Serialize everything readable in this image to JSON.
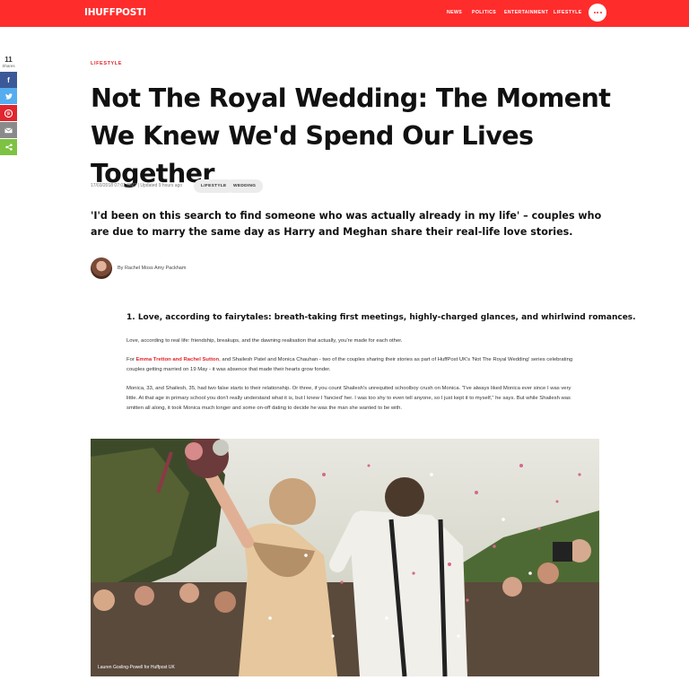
{
  "header": {
    "logo": "IHUFFPOSTI",
    "nav": [
      "NEWS",
      "POLITICS",
      "ENTERTAINMENT",
      "LIFESTYLE"
    ],
    "brand_color": "#ff2c2c"
  },
  "share": {
    "count": "11",
    "label": "Shares",
    "buttons": [
      {
        "name": "facebook",
        "glyph": "f",
        "color": "#3b5998"
      },
      {
        "name": "twitter",
        "glyph": "t",
        "color": "#55acee"
      },
      {
        "name": "pinterest",
        "glyph": "p",
        "color": "#e0262e"
      },
      {
        "name": "email",
        "glyph": "✉",
        "color": "#8a8a8a"
      },
      {
        "name": "share",
        "glyph": "<",
        "color": "#7dc242"
      }
    ]
  },
  "article": {
    "section": "LIFESTYLE",
    "headline": "Not The Royal Wedding: The Moment We Knew We'd Spend Our Lives Together",
    "timestamp": "17/03/2018 07:01 GMT | Updated 9 hours ago",
    "tags": [
      "LIFESTYLE",
      "WEDDING"
    ],
    "standfirst": "'I'd been on this search to find someone who was actually already in my life' – couples who are due to marry the same day as Harry and Meghan share their real-life love stories.",
    "byline": "By Rachel Moss  Amy Packham",
    "subhead": "1. Love, according to fairytales: breath-taking first meetings, highly-charged glances, and whirlwind romances.",
    "p1": "Love, according to real life: friendship, breakups, and the dawning realisation that actually, you're made for each other.",
    "p2_link": "Emma Tretton and Rachel Sutton",
    "p2_rest": ", and Shailesh Patel and Monica Chauhan - two of the couples sharing their stories as part of HuffPost UK's 'Not The Royal Wedding' series celebrating couples getting married on 19 May - it was absence that made their hearts grow fonder.",
    "p2_prefix": "For ",
    "p3": "Monica, 33, and Shailesh, 35, had two false starts to their relationship. Or three, if you count Shailesh's unrequited schoolboy crush on Monica. \"I've always liked Monica ever since I was very little. At that age in primary school you don't really understand what it is, but I knew I 'fancied' her. I was too shy to even tell anyone, so I just kept it to myself,\" he says. But while Shailesh was smitten all along, it took Monica much longer and some on-off dating to decide he was the man she wanted to be with.",
    "photo_caption": "Lauren Gosling-Powell for Huffpost UK"
  }
}
